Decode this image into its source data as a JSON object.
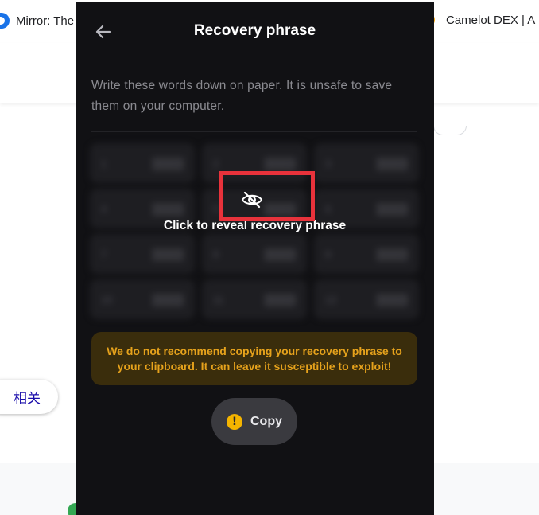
{
  "browser": {
    "bookmark_left": "Mirror: The",
    "bookmark_right": "Camelot DEX | A"
  },
  "background": {
    "related_chip": "相关"
  },
  "popup": {
    "title": "Recovery phrase",
    "back_icon": "arrow-left-icon",
    "instructions": "Write these words down on paper. It is unsafe to save them on your computer.",
    "reveal_icon": "eye-off-icon",
    "reveal_text": "Click to reveal recovery phrase",
    "warning": "We do not recommend copying your recovery phrase to your clipboard. It can leave it susceptible to exploit!",
    "copy_label": "Copy",
    "copy_icon": "exclamation-circle-icon"
  },
  "colors": {
    "popup_bg": "#111114",
    "warning_bg": "#3a2d0c",
    "warning_text": "#e6a21c",
    "highlight": "#e8323b",
    "copy_icon": "#f4b400"
  }
}
